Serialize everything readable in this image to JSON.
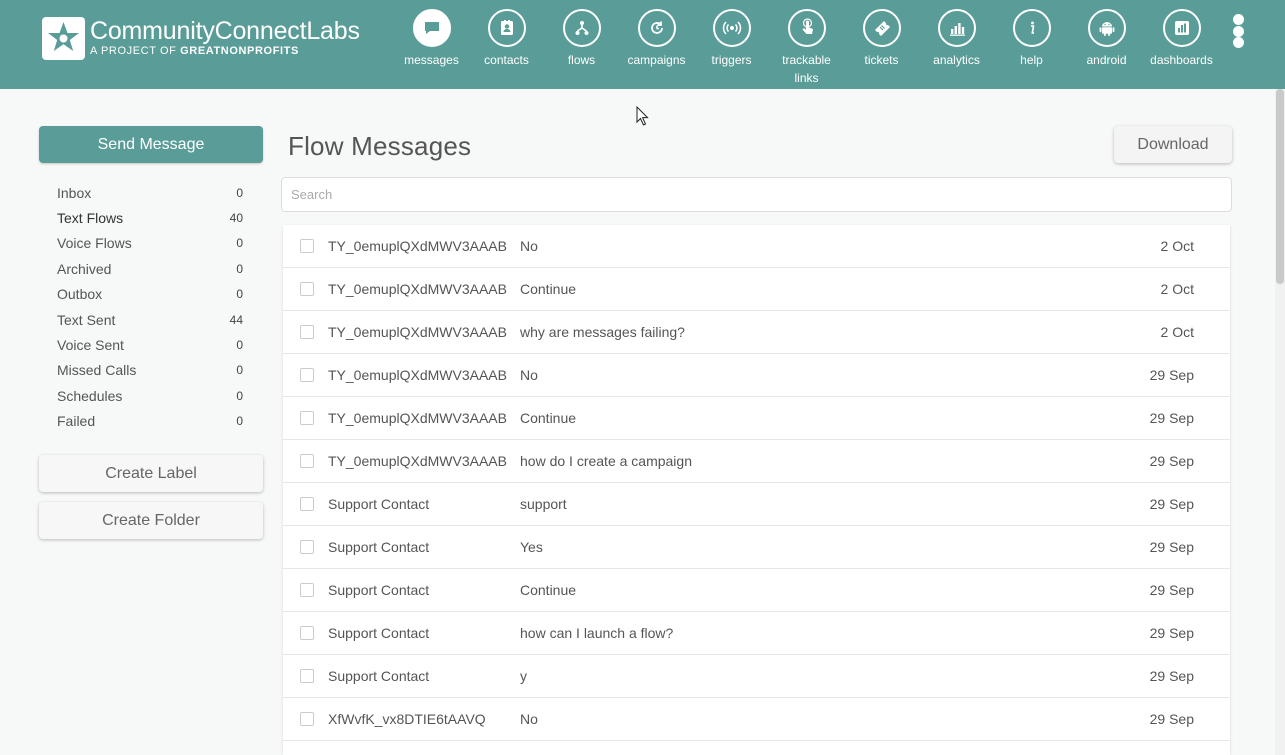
{
  "brand": {
    "title": "CommunityConnectLabs",
    "title_part1": "CommunityConnect",
    "title_part2": "Labs",
    "subtitle_prefix": "A PROJECT OF ",
    "subtitle_org": "GREATNONPROFITS"
  },
  "nav": [
    {
      "label": "messages",
      "icon": "chat-bubble-icon",
      "active": true
    },
    {
      "label": "contacts",
      "icon": "contact-card-icon"
    },
    {
      "label": "flows",
      "icon": "flow-tree-icon"
    },
    {
      "label": "campaigns",
      "icon": "refresh-clock-icon"
    },
    {
      "label": "triggers",
      "icon": "broadcast-icon"
    },
    {
      "label": "trackable links",
      "icon": "pointer-hand-icon"
    },
    {
      "label": "tickets",
      "icon": "ticket-icon"
    },
    {
      "label": "analytics",
      "icon": "bar-chart-icon"
    },
    {
      "label": "help",
      "icon": "info-icon"
    },
    {
      "label": "android",
      "icon": "android-icon"
    },
    {
      "label": "dashboards",
      "icon": "dashboard-chart-icon"
    }
  ],
  "sidebar": {
    "send_label": "Send Message",
    "folders": [
      {
        "label": "Inbox",
        "count": "0"
      },
      {
        "label": "Text Flows",
        "count": "40",
        "active": true
      },
      {
        "label": "Voice Flows",
        "count": "0"
      },
      {
        "label": "Archived",
        "count": "0"
      },
      {
        "label": "Outbox",
        "count": "0"
      },
      {
        "label": "Text Sent",
        "count": "44"
      },
      {
        "label": "Voice Sent",
        "count": "0"
      },
      {
        "label": "Missed Calls",
        "count": "0"
      },
      {
        "label": "Schedules",
        "count": "0"
      },
      {
        "label": "Failed",
        "count": "0"
      }
    ],
    "create_label": "Create Label",
    "create_folder": "Create Folder"
  },
  "main": {
    "title": "Flow Messages",
    "download_label": "Download",
    "search_placeholder": "Search",
    "messages": [
      {
        "contact": "TY_0emuplQXdMWV3AAAB",
        "text": "No",
        "date": "2 Oct"
      },
      {
        "contact": "TY_0emuplQXdMWV3AAAB",
        "text": "Continue",
        "date": "2 Oct"
      },
      {
        "contact": "TY_0emuplQXdMWV3AAAB",
        "text": "why are messages failing?",
        "date": "2 Oct"
      },
      {
        "contact": "TY_0emuplQXdMWV3AAAB",
        "text": "No",
        "date": "29 Sep"
      },
      {
        "contact": "TY_0emuplQXdMWV3AAAB",
        "text": "Continue",
        "date": "29 Sep"
      },
      {
        "contact": "TY_0emuplQXdMWV3AAAB",
        "text": "how do I create a campaign",
        "date": "29 Sep"
      },
      {
        "contact": "Support Contact",
        "text": "support",
        "date": "29 Sep"
      },
      {
        "contact": "Support Contact",
        "text": "Yes",
        "date": "29 Sep"
      },
      {
        "contact": "Support Contact",
        "text": "Continue",
        "date": "29 Sep"
      },
      {
        "contact": "Support Contact",
        "text": "how can I launch a flow?",
        "date": "29 Sep"
      },
      {
        "contact": "Support Contact",
        "text": "y",
        "date": "29 Sep"
      },
      {
        "contact": "XfWvfK_vx8DTIE6tAAVQ",
        "text": "No",
        "date": "29 Sep"
      }
    ]
  },
  "colors": {
    "brand": "#5a9d98",
    "background": "#f7f8f8"
  }
}
